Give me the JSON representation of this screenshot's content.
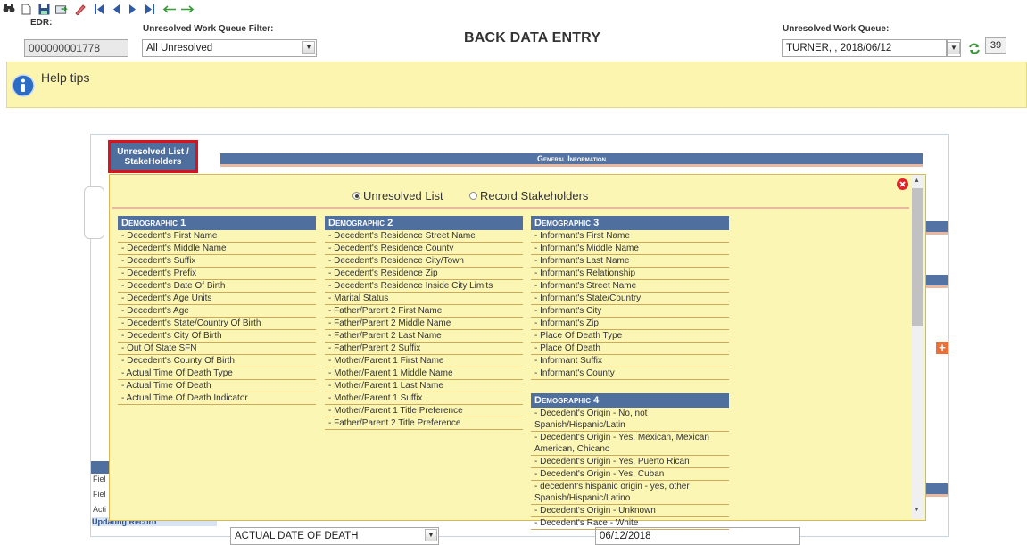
{
  "toolbar": {
    "icons": [
      "search-icon",
      "new-document-icon",
      "save-icon",
      "export-icon",
      "eraser-icon",
      "first-record-icon",
      "previous-record-icon",
      "next-record-icon",
      "last-record-icon",
      "back-arrow-icon",
      "forward-arrow-icon"
    ]
  },
  "header": {
    "edr_label": "EDR:",
    "edr_value": "000000001778",
    "filter_label": "Unresolved Work Queue Filter:",
    "filter_value": "All Unresolved",
    "page_title": "BACK DATA ENTRY",
    "queue_label": "Unresolved Work Queue:",
    "queue_value": "TURNER, , 2018/06/12",
    "queue_count": "39"
  },
  "help": {
    "label": "Help tips"
  },
  "panel": {
    "tab_label": "Unresolved List / StakeHolders",
    "general_information": "General Information",
    "side_rows": [
      "Fiel",
      "Fiel",
      "Acti",
      "Upc"
    ],
    "side_footer": "Updating Record",
    "bottom_select_value": "ACTUAL DATE OF DEATH",
    "bottom_date_value": "06/12/2018"
  },
  "popup": {
    "radio_unresolved": "Unresolved List",
    "radio_stakeholders": "Record Stakeholders",
    "selected": "Unresolved List",
    "demographic1": {
      "title": "Demographic 1",
      "items": [
        "- Decedent's First Name",
        "- Decedent's Middle Name",
        "- Decedent's Suffix",
        "- Decedent's Prefix",
        "- Decedent's Date Of Birth",
        "- Decedent's Age Units",
        "- Decedent's Age",
        "- Decedent's State/Country Of Birth",
        "- Decedent's City Of Birth",
        "- Out Of State SFN",
        "- Decedent's County Of Birth",
        "- Actual Time Of Death Type",
        "- Actual Time Of Death",
        "- Actual Time Of Death Indicator"
      ]
    },
    "demographic2": {
      "title": "Demographic 2",
      "items": [
        "- Decedent's Residence Street Name",
        "- Decedent's Residence County",
        "- Decedent's Residence City/Town",
        "- Decedent's Residence Zip",
        "- Decedent's Residence Inside City Limits",
        "- Marital Status",
        "- Father/Parent 2 First Name",
        "- Father/Parent 2 Middle Name",
        "- Father/Parent 2 Last Name",
        "- Father/Parent 2 Suffix",
        "- Mother/Parent 1 First Name",
        "- Mother/Parent 1 Middle Name",
        "- Mother/Parent 1 Last Name",
        "- Mother/Parent 1 Suffix",
        "- Mother/Parent 1 Title Preference",
        "- Father/Parent 2 Title Preference"
      ]
    },
    "demographic3": {
      "title": "Demographic 3",
      "items": [
        "- Informant's First Name",
        "- Informant's Middle Name",
        "- Informant's Last Name",
        "- Informant's Relationship",
        "- Informant's Street Name",
        "- Informant's State/Country",
        "- Informant's City",
        "- Informant's Zip",
        "- Place Of Death Type",
        "- Place Of Death",
        "- Informant Suffix",
        "- Informant's County"
      ]
    },
    "demographic4": {
      "title": "Demographic 4",
      "items": [
        "- Decedent's Origin - No, not Spanish/Hispanic/Latin",
        "- Decedent's Origin - Yes, Mexican, Mexican American, Chicano",
        "- Decedent's Origin - Yes, Puerto Rican",
        "- Decedent's Origin - Yes, Cuban",
        "- decedent's hispanic origin - yes, other Spanish/Hispanic/Latino",
        "- Decedent's Origin - Unknown",
        "- Decedent's Race - White"
      ]
    }
  },
  "colors": {
    "accent_blue": "#4f6f9f",
    "popup_bg": "#fcf6b4",
    "help_bg": "#fcf5b0",
    "tab_highlight": "#e0101a"
  }
}
